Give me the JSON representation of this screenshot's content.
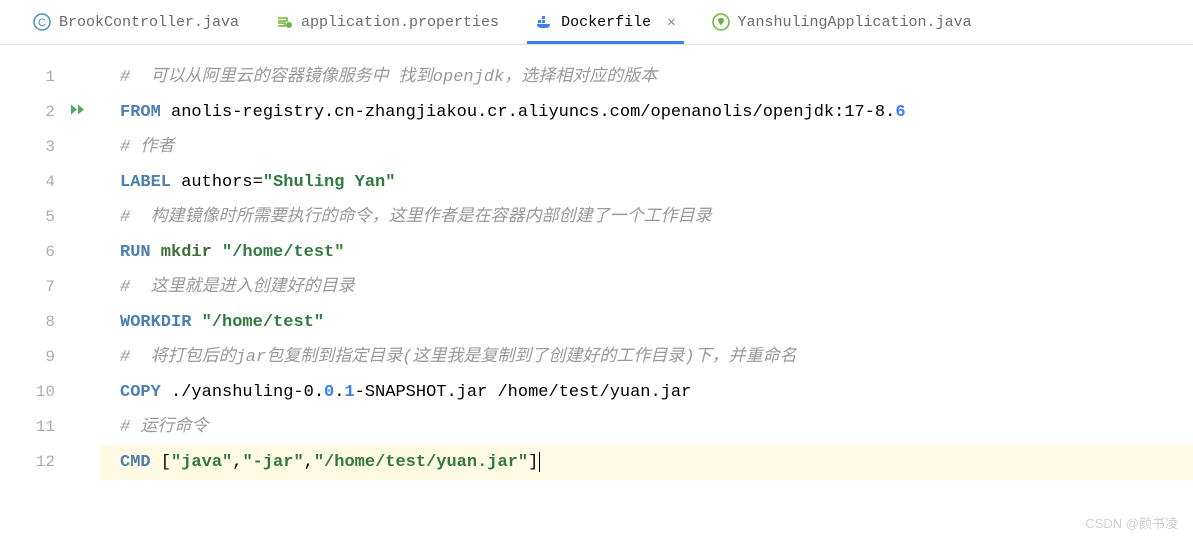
{
  "tabs": [
    {
      "name": "BrookController.java",
      "icon": "class",
      "active": false,
      "closable": false
    },
    {
      "name": "application.properties",
      "icon": "spring-config",
      "active": false,
      "closable": false
    },
    {
      "name": "Dockerfile",
      "icon": "docker",
      "active": true,
      "closable": true
    },
    {
      "name": "YanshulingApplication.java",
      "icon": "spring-app",
      "active": false,
      "closable": false
    }
  ],
  "code": {
    "lines": [
      {
        "num": "1",
        "comment": "#  可以从阿里云的容器镜像服务中 找到openjdk，选择相对应的版本"
      },
      {
        "num": "2",
        "hasRun": true,
        "keyword": "FROM",
        "rest": " anolis-registry.cn-zhangjiakou.cr.aliyuncs.com/openanolis/openjdk:17-8.",
        "version": "6"
      },
      {
        "num": "3",
        "comment": "# 作者"
      },
      {
        "num": "4",
        "keyword": "LABEL",
        "rest": " authors=",
        "string": "\"Shuling Yan\""
      },
      {
        "num": "5",
        "comment": "#  构建镜像时所需要执行的命令，这里作者是在容器内部创建了一个工作目录"
      },
      {
        "num": "6",
        "keyword": "RUN",
        "cmd": " mkdir ",
        "string": "\"/home/test\""
      },
      {
        "num": "7",
        "comment": "#  这里就是进入创建好的目录"
      },
      {
        "num": "8",
        "keyword": "WORKDIR",
        "rest": " ",
        "string": "\"/home/test\""
      },
      {
        "num": "9",
        "comment": "#  将打包后的jar包复制到指定目录(这里我是复制到了创建好的工作目录)下，并重命名"
      },
      {
        "num": "10",
        "keyword": "COPY",
        "rest": " ./yanshuling-0.",
        "v1": "0",
        "dot1": ".",
        "v2": "1",
        "rest2": "-SNAPSHOT.jar /home/test/yuan.jar"
      },
      {
        "num": "11",
        "comment": "# 运行命令"
      },
      {
        "num": "12",
        "current": true,
        "keyword": "CMD",
        "rest": " [",
        "s1": "\"java\"",
        "c1": ",",
        "s2": "\"-jar\"",
        "c2": ",",
        "s3": "\"/home/test/yuan.jar\"",
        "end": "]"
      }
    ]
  },
  "watermark": "CSDN @颜书凌"
}
